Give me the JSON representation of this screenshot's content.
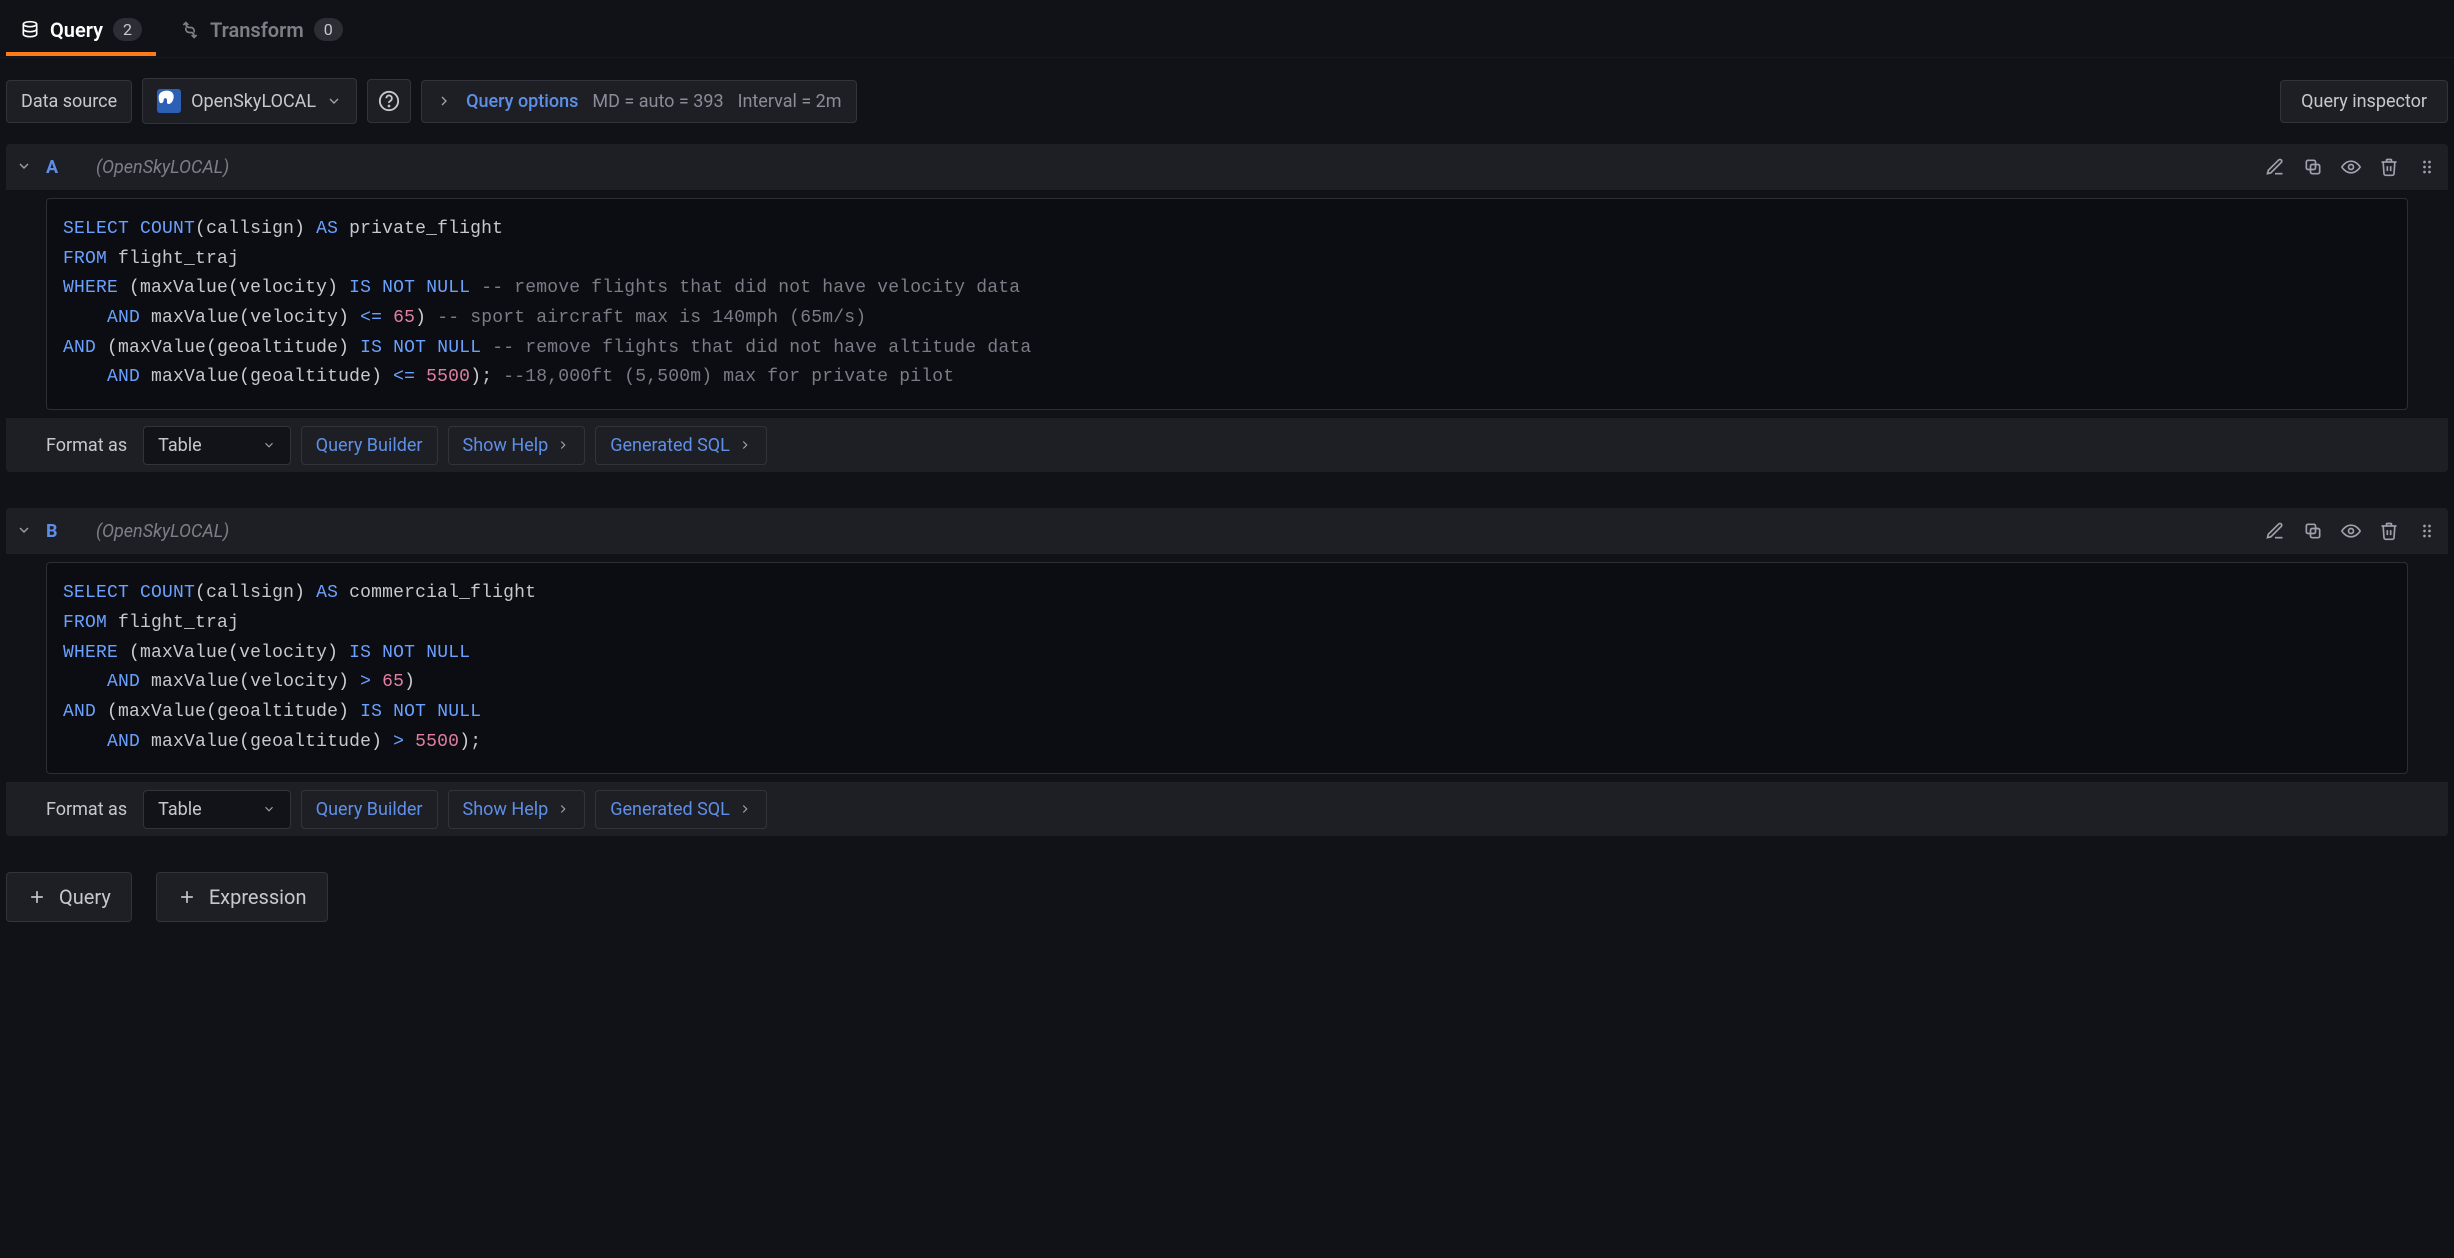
{
  "tabs": {
    "query": {
      "label": "Query",
      "badge": "2"
    },
    "transform": {
      "label": "Transform",
      "badge": "0"
    }
  },
  "toolbar": {
    "data_source_label": "Data source",
    "data_source_value": "OpenSkyLOCAL",
    "query_options_label": "Query options",
    "md_text": "MD = auto = 393",
    "interval_text": "Interval = 2m",
    "inspector_label": "Query inspector"
  },
  "queries": [
    {
      "letter": "A",
      "datasource": "(OpenSkyLOCAL)",
      "sql_segments": [
        {
          "t": "kw",
          "v": "SELECT"
        },
        {
          "t": "sp",
          "v": " "
        },
        {
          "t": "fn",
          "v": "COUNT"
        },
        {
          "t": "p",
          "v": "("
        },
        {
          "t": "plain",
          "v": "callsign"
        },
        {
          "t": "p",
          "v": ")"
        },
        {
          "t": "sp",
          "v": " "
        },
        {
          "t": "kw",
          "v": "AS"
        },
        {
          "t": "sp",
          "v": " "
        },
        {
          "t": "plain",
          "v": "private_flight"
        },
        {
          "t": "nl"
        },
        {
          "t": "kw",
          "v": "FROM"
        },
        {
          "t": "sp",
          "v": " "
        },
        {
          "t": "plain",
          "v": "flight_traj"
        },
        {
          "t": "nl"
        },
        {
          "t": "kw",
          "v": "WHERE"
        },
        {
          "t": "sp",
          "v": " "
        },
        {
          "t": "p",
          "v": "("
        },
        {
          "t": "plain",
          "v": "maxValue"
        },
        {
          "t": "p",
          "v": "("
        },
        {
          "t": "plain",
          "v": "velocity"
        },
        {
          "t": "p",
          "v": ")"
        },
        {
          "t": "sp",
          "v": " "
        },
        {
          "t": "kw",
          "v": "IS"
        },
        {
          "t": "sp",
          "v": " "
        },
        {
          "t": "kw",
          "v": "NOT"
        },
        {
          "t": "sp",
          "v": " "
        },
        {
          "t": "kw",
          "v": "NULL"
        },
        {
          "t": "sp",
          "v": " "
        },
        {
          "t": "comment",
          "v": "-- remove flights that did not have velocity data"
        },
        {
          "t": "nl"
        },
        {
          "t": "sp",
          "v": "    "
        },
        {
          "t": "kw",
          "v": "AND"
        },
        {
          "t": "sp",
          "v": " "
        },
        {
          "t": "plain",
          "v": "maxValue"
        },
        {
          "t": "p",
          "v": "("
        },
        {
          "t": "plain",
          "v": "velocity"
        },
        {
          "t": "p",
          "v": ")"
        },
        {
          "t": "sp",
          "v": " "
        },
        {
          "t": "op",
          "v": "<="
        },
        {
          "t": "sp",
          "v": " "
        },
        {
          "t": "num",
          "v": "65"
        },
        {
          "t": "p",
          "v": ")"
        },
        {
          "t": "sp",
          "v": " "
        },
        {
          "t": "comment",
          "v": "-- sport aircraft max is 140mph (65m/s)"
        },
        {
          "t": "nl"
        },
        {
          "t": "kw",
          "v": "AND"
        },
        {
          "t": "sp",
          "v": " "
        },
        {
          "t": "p",
          "v": "("
        },
        {
          "t": "plain",
          "v": "maxValue"
        },
        {
          "t": "p",
          "v": "("
        },
        {
          "t": "plain",
          "v": "geoaltitude"
        },
        {
          "t": "p",
          "v": ")"
        },
        {
          "t": "sp",
          "v": " "
        },
        {
          "t": "kw",
          "v": "IS"
        },
        {
          "t": "sp",
          "v": " "
        },
        {
          "t": "kw",
          "v": "NOT"
        },
        {
          "t": "sp",
          "v": " "
        },
        {
          "t": "kw",
          "v": "NULL"
        },
        {
          "t": "sp",
          "v": " "
        },
        {
          "t": "comment",
          "v": "-- remove flights that did not have altitude data"
        },
        {
          "t": "nl"
        },
        {
          "t": "sp",
          "v": "    "
        },
        {
          "t": "kw",
          "v": "AND"
        },
        {
          "t": "sp",
          "v": " "
        },
        {
          "t": "plain",
          "v": "maxValue"
        },
        {
          "t": "p",
          "v": "("
        },
        {
          "t": "plain",
          "v": "geoaltitude"
        },
        {
          "t": "p",
          "v": ")"
        },
        {
          "t": "sp",
          "v": " "
        },
        {
          "t": "op",
          "v": "<="
        },
        {
          "t": "sp",
          "v": " "
        },
        {
          "t": "num",
          "v": "5500"
        },
        {
          "t": "p",
          "v": ")"
        },
        {
          "t": "plain",
          "v": ";"
        },
        {
          "t": "sp",
          "v": " "
        },
        {
          "t": "comment",
          "v": "--18,000ft (5,500m) max for private pilot"
        }
      ],
      "footer": {
        "format_as_label": "Format as",
        "format_as_value": "Table",
        "builder_label": "Query Builder",
        "show_help_label": "Show Help",
        "generated_sql_label": "Generated SQL"
      }
    },
    {
      "letter": "B",
      "datasource": "(OpenSkyLOCAL)",
      "sql_segments": [
        {
          "t": "kw",
          "v": "SELECT"
        },
        {
          "t": "sp",
          "v": " "
        },
        {
          "t": "fn",
          "v": "COUNT"
        },
        {
          "t": "p",
          "v": "("
        },
        {
          "t": "plain",
          "v": "callsign"
        },
        {
          "t": "p",
          "v": ")"
        },
        {
          "t": "sp",
          "v": " "
        },
        {
          "t": "kw",
          "v": "AS"
        },
        {
          "t": "sp",
          "v": " "
        },
        {
          "t": "plain",
          "v": "commercial_flight"
        },
        {
          "t": "nl"
        },
        {
          "t": "kw",
          "v": "FROM"
        },
        {
          "t": "sp",
          "v": " "
        },
        {
          "t": "plain",
          "v": "flight_traj"
        },
        {
          "t": "nl"
        },
        {
          "t": "kw",
          "v": "WHERE"
        },
        {
          "t": "sp",
          "v": " "
        },
        {
          "t": "p",
          "v": "("
        },
        {
          "t": "plain",
          "v": "maxValue"
        },
        {
          "t": "p",
          "v": "("
        },
        {
          "t": "plain",
          "v": "velocity"
        },
        {
          "t": "p",
          "v": ")"
        },
        {
          "t": "sp",
          "v": " "
        },
        {
          "t": "kw",
          "v": "IS"
        },
        {
          "t": "sp",
          "v": " "
        },
        {
          "t": "kw",
          "v": "NOT"
        },
        {
          "t": "sp",
          "v": " "
        },
        {
          "t": "kw",
          "v": "NULL"
        },
        {
          "t": "nl"
        },
        {
          "t": "sp",
          "v": "    "
        },
        {
          "t": "kw",
          "v": "AND"
        },
        {
          "t": "sp",
          "v": " "
        },
        {
          "t": "plain",
          "v": "maxValue"
        },
        {
          "t": "p",
          "v": "("
        },
        {
          "t": "plain",
          "v": "velocity"
        },
        {
          "t": "p",
          "v": ")"
        },
        {
          "t": "sp",
          "v": " "
        },
        {
          "t": "op",
          "v": ">"
        },
        {
          "t": "sp",
          "v": " "
        },
        {
          "t": "num",
          "v": "65"
        },
        {
          "t": "p",
          "v": ")"
        },
        {
          "t": "nl"
        },
        {
          "t": "kw",
          "v": "AND"
        },
        {
          "t": "sp",
          "v": " "
        },
        {
          "t": "p",
          "v": "("
        },
        {
          "t": "plain",
          "v": "maxValue"
        },
        {
          "t": "p",
          "v": "("
        },
        {
          "t": "plain",
          "v": "geoaltitude"
        },
        {
          "t": "p",
          "v": ")"
        },
        {
          "t": "sp",
          "v": " "
        },
        {
          "t": "kw",
          "v": "IS"
        },
        {
          "t": "sp",
          "v": " "
        },
        {
          "t": "kw",
          "v": "NOT"
        },
        {
          "t": "sp",
          "v": " "
        },
        {
          "t": "kw",
          "v": "NULL"
        },
        {
          "t": "nl"
        },
        {
          "t": "sp",
          "v": "    "
        },
        {
          "t": "kw",
          "v": "AND"
        },
        {
          "t": "sp",
          "v": " "
        },
        {
          "t": "plain",
          "v": "maxValue"
        },
        {
          "t": "p",
          "v": "("
        },
        {
          "t": "plain",
          "v": "geoaltitude"
        },
        {
          "t": "p",
          "v": ")"
        },
        {
          "t": "sp",
          "v": " "
        },
        {
          "t": "op",
          "v": ">"
        },
        {
          "t": "sp",
          "v": " "
        },
        {
          "t": "num",
          "v": "5500"
        },
        {
          "t": "p",
          "v": ")"
        },
        {
          "t": "plain",
          "v": ";"
        }
      ],
      "footer": {
        "format_as_label": "Format as",
        "format_as_value": "Table",
        "builder_label": "Query Builder",
        "show_help_label": "Show Help",
        "generated_sql_label": "Generated SQL"
      }
    }
  ],
  "actions": {
    "add_query_label": "Query",
    "add_expression_label": "Expression"
  }
}
